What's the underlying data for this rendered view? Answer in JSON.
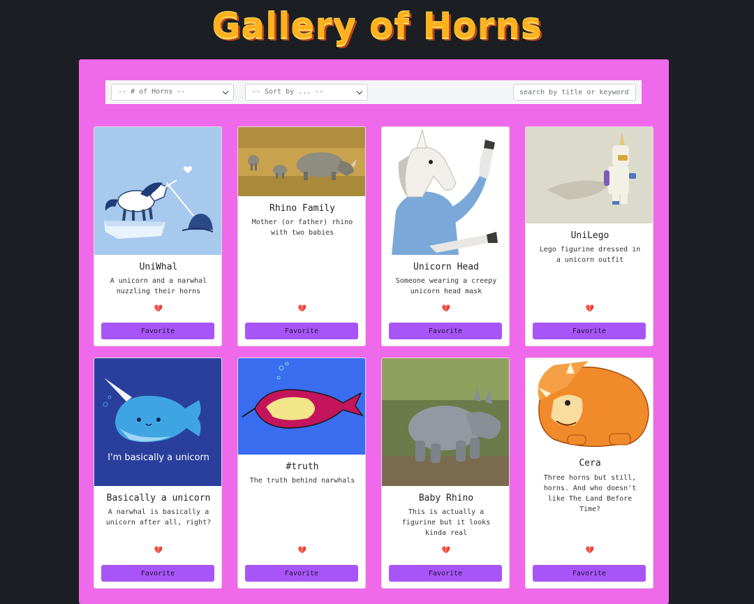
{
  "header": {
    "title": "Gallery of Horns"
  },
  "filters": {
    "horns_select": {
      "selected": "-- # of Horns --"
    },
    "sort_select": {
      "selected": "-- Sort by ... --"
    },
    "search": {
      "placeholder": "search by title or keyword"
    }
  },
  "cards": [
    {
      "title": "UniWhal",
      "description": "A unicorn and a narwhal nuzzling their horns",
      "favorite_icon": "broken-heart",
      "heart": "💔",
      "button": "Favorite"
    },
    {
      "title": "Rhino Family",
      "description": "Mother (or father) rhino with two babies",
      "favorite_icon": "broken-heart",
      "heart": "💔",
      "button": "Favorite"
    },
    {
      "title": "Unicorn Head",
      "description": "Someone wearing a creepy unicorn head mask",
      "favorite_icon": "broken-heart",
      "heart": "💔",
      "button": "Favorite"
    },
    {
      "title": "UniLego",
      "description": "Lego figurine dressed in a unicorn outfit",
      "favorite_icon": "broken-heart",
      "heart": "💔",
      "button": "Favorite"
    },
    {
      "title": "Basically a unicorn",
      "description": "A narwhal is basically a unicorn after all, right?",
      "image_caption": "I'm basically a unicorn",
      "favorite_icon": "broken-heart",
      "heart": "💔",
      "button": "Favorite"
    },
    {
      "title": "#truth",
      "description": "The truth behind narwhals",
      "favorite_icon": "broken-heart",
      "heart": "💔",
      "button": "Favorite"
    },
    {
      "title": "Baby Rhino",
      "description": "This is actually a figurine but it looks kinda real",
      "favorite_icon": "broken-heart",
      "heart": "💔",
      "button": "Favorite"
    },
    {
      "title": "Cera",
      "description": "Three horns but still, horns. And who doesn't like The Land Before Time?",
      "favorite_icon": "broken-heart",
      "heart": "💔",
      "button": "Favorite"
    }
  ],
  "colors": {
    "background": "#1b1e22",
    "panel": "#ef6aea",
    "button": "#a855f7",
    "title": "#ffb11e"
  }
}
